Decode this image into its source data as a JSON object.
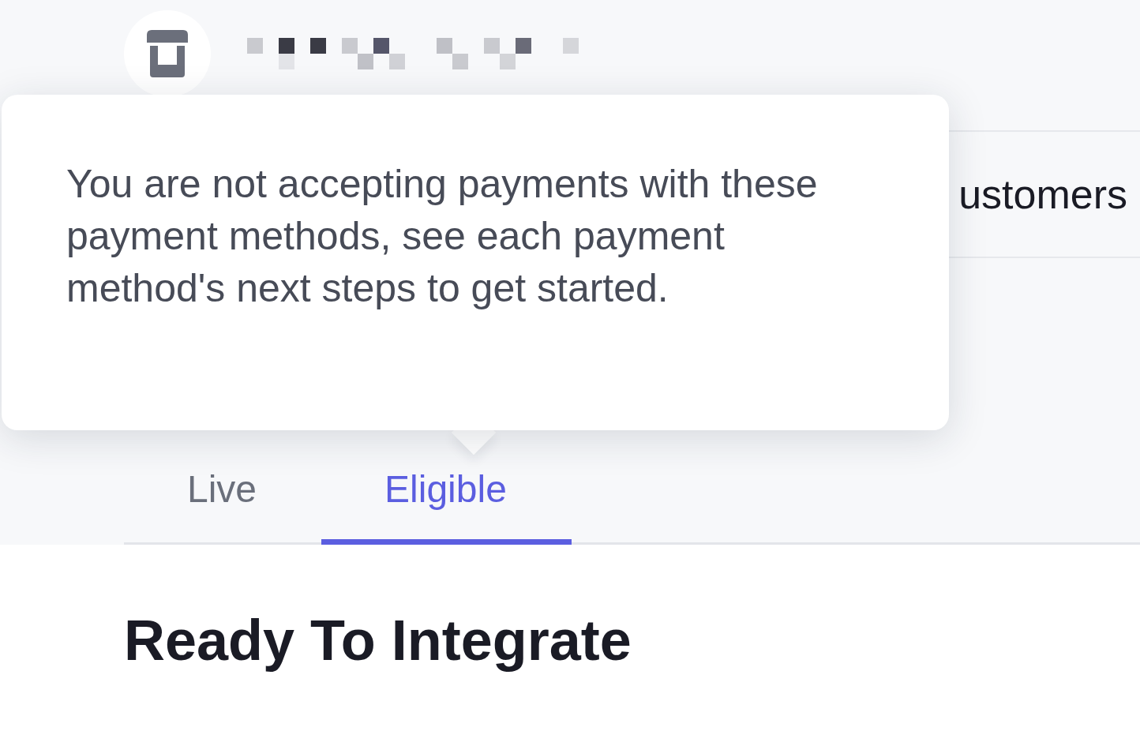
{
  "nav": {
    "items": [
      "ustomers"
    ]
  },
  "tabs": [
    {
      "label": "Live",
      "selected": false
    },
    {
      "label": "Eligible",
      "selected": true
    }
  ],
  "heading": "Ready To Integrate",
  "tooltip": {
    "text": "You are not accepting payments with these payment methods, see each payment method's next steps to get started."
  }
}
